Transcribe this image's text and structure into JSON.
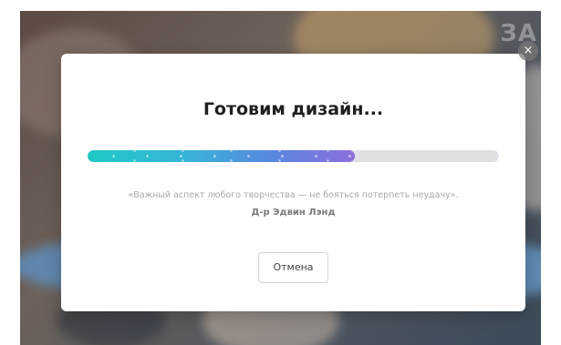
{
  "background": {
    "corner_text": "ЗА"
  },
  "dialog": {
    "title": "Готовим дизайн...",
    "progress": 0.65,
    "progress_colors": [
      "#1fc9c4",
      "#8d6fdc"
    ],
    "quote": "«Важный аспект любого творчества — не бояться потерпеть неудачу».",
    "author": "Д-р Эдвин Лэнд",
    "cancel_label": "Отмена",
    "close_icon": "×"
  }
}
